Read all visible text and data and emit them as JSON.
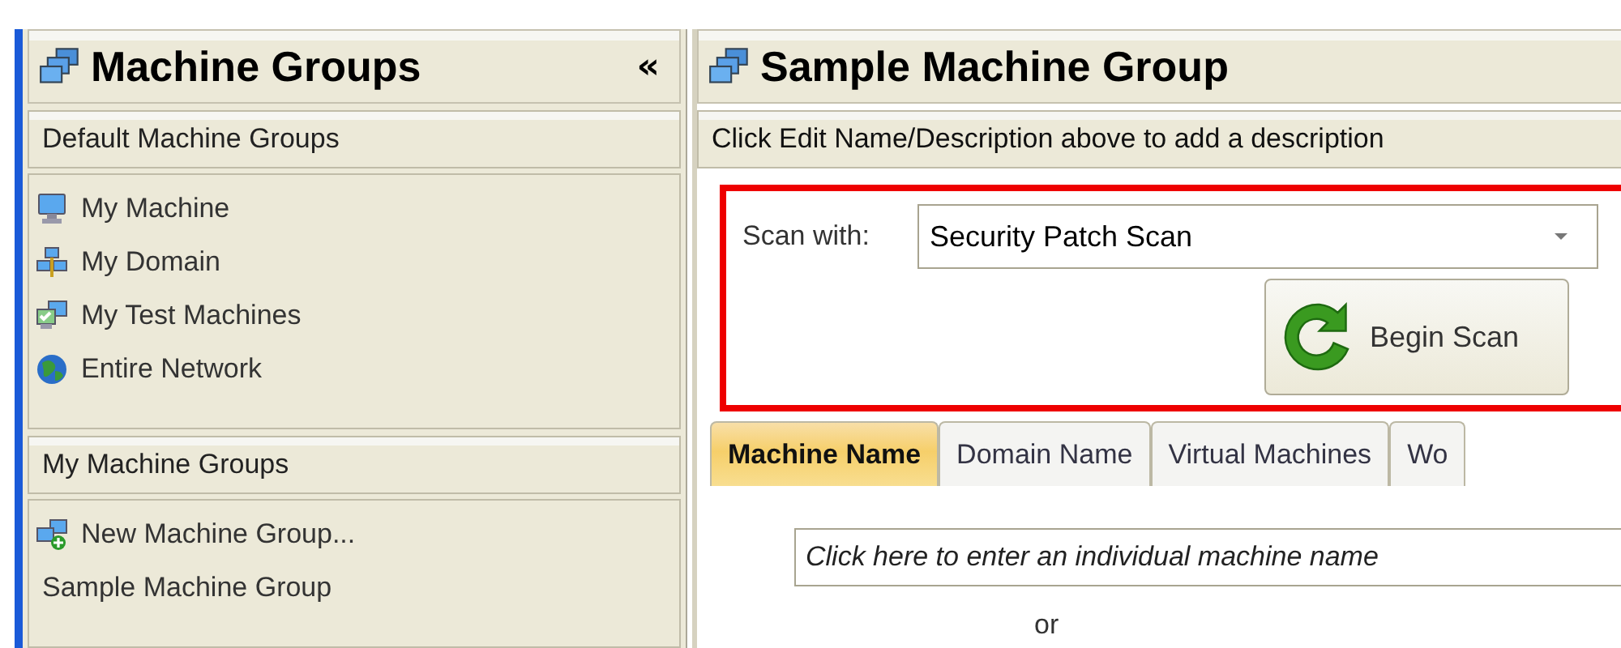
{
  "left_panel": {
    "title": "Machine Groups",
    "collapse": "«",
    "sections": [
      {
        "title": "Default Machine Groups",
        "items": [
          {
            "label": "My Machine",
            "kind": "monitor"
          },
          {
            "label": "My Domain",
            "kind": "domain"
          },
          {
            "label": "My Test Machines",
            "kind": "test"
          },
          {
            "label": "Entire Network",
            "kind": "globe"
          }
        ]
      },
      {
        "title": "My Machine Groups",
        "items": [
          {
            "label": "New Machine Group...",
            "kind": "new"
          },
          {
            "label": "Sample Machine Group",
            "kind": "plain"
          }
        ]
      }
    ]
  },
  "main_panel": {
    "title": "Sample Machine Group",
    "description": "Click Edit Name/Description above to add a description",
    "scan_with_label": "Scan with:",
    "scan_template": "Security Patch Scan",
    "begin_scan": "Begin Scan",
    "tabs": [
      {
        "label": "Machine Name",
        "selected": true
      },
      {
        "label": "Domain Name",
        "selected": false
      },
      {
        "label": "Virtual Machines",
        "selected": false
      },
      {
        "label": "Wo",
        "selected": false
      }
    ],
    "machine_name_field": {
      "placeholder": "Click here to enter an individual machine name"
    },
    "or_text": "or"
  }
}
